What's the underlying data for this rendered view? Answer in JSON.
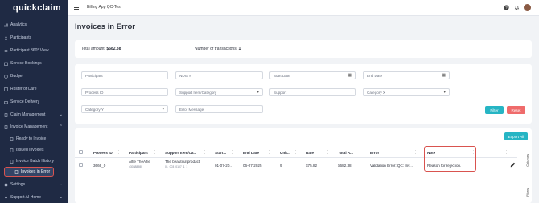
{
  "sidebar": {
    "logo": "quickclaim",
    "items": [
      {
        "label": "Analytics",
        "icon": "analytics-icon"
      },
      {
        "label": "Participants",
        "icon": "people-icon"
      },
      {
        "label": "Participant 360° View",
        "icon": "eye-icon"
      },
      {
        "label": "Service Bookings",
        "icon": "booking-icon"
      },
      {
        "label": "Budget",
        "icon": "budget-icon"
      },
      {
        "label": "Roster of Care",
        "icon": "roster-icon"
      },
      {
        "label": "Service Delivery",
        "icon": "delivery-icon"
      },
      {
        "label": "Claim Management",
        "icon": "claim-icon"
      },
      {
        "label": "Invoice Management",
        "icon": "invoice-icon"
      },
      {
        "label": "Ready to Invoice",
        "icon": "doc-icon"
      },
      {
        "label": "Issued Invoices",
        "icon": "doc-icon"
      },
      {
        "label": "Invoice Batch History",
        "icon": "doc-icon"
      },
      {
        "label": "Invoices in Error",
        "icon": "doc-icon"
      },
      {
        "label": "Settings",
        "icon": "gear-icon"
      },
      {
        "label": "Support AI Home",
        "icon": "support-icon"
      }
    ]
  },
  "topbar": {
    "app_title": "Billing App QC-Test"
  },
  "page": {
    "title": "Invoices in Error"
  },
  "summary": {
    "total_amount_label": "Total amount:",
    "total_amount_value": "$682.38",
    "transactions_label": "Number of transactions:",
    "transactions_value": "1"
  },
  "filters": {
    "participant": "Participant",
    "ndis": "NDIS #",
    "start_date": "Start Date",
    "end_date": "End Date",
    "process_id": "Process ID",
    "support_item": "Support Item/Category",
    "support": "Support",
    "category_x": "Category X",
    "category_y": "Category Y",
    "error_message": "Error Message",
    "filter_button": "Filter",
    "reset_button": "Reset"
  },
  "grid": {
    "export_button": "Export All",
    "columns": [
      "Process ID",
      "Participant",
      "Support Item/Ca...",
      "Start...",
      "End Date",
      "Unit...",
      "Rate",
      "Total A...",
      "Error",
      "Note"
    ],
    "row": {
      "process_id": "3666_0",
      "participant": "Alfie TheAlfie",
      "participant_sub": "430388980",
      "support_item": "The beautiful product",
      "support_item_sub": "01_003_0107_1_1",
      "start": "01-07-20...",
      "end_date": "06-07-2025",
      "units": "9",
      "rate": "$75.82",
      "total": "$682.38",
      "error": "Validation Error: QC: Inv...",
      "note": "Reason for rejection."
    },
    "side_tabs": [
      "Columns",
      "Filters"
    ]
  },
  "colors": {
    "sidebar": "#1f2a44",
    "filter_button": "#26b5c4",
    "reset_button": "#ef6b6b",
    "export_button": "#26b5c4",
    "highlight": "#d9534f"
  }
}
